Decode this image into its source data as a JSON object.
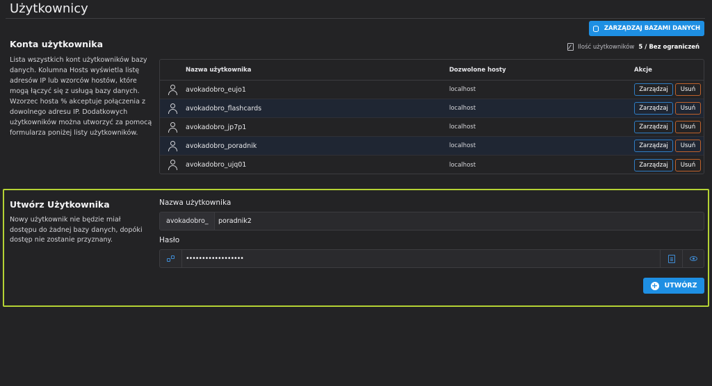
{
  "page": {
    "title": "Użytkownicy",
    "manage_db_label": "ZARZĄDZAJ BAZAMI DANYCH"
  },
  "accounts": {
    "title": "Konta użytkownika",
    "description": "Lista wszystkich kont użytkowników bazy danych. Kolumna Hosts wyświetla listę adresów IP lub wzorców hostów, które mogą łączyć się z usługą bazy danych. Wzorzec hosta % akceptuje połączenia z dowolnego adresu IP. Dodatkowych użytkowników można utworzyć za pomocą formularza poniżej listy użytkowników.",
    "count_label": "Ilość użytkowników",
    "count_value": "5 / Bez ograniczeń",
    "columns": [
      "Nazwa użytkownika",
      "Dozwolone hosty",
      "Akcje"
    ],
    "manage_label": "Zarządzaj",
    "delete_label": "Usuń",
    "rows": [
      {
        "name": "avokadobro_eujo1",
        "host": "localhost"
      },
      {
        "name": "avokadobro_flashcards",
        "host": "localhost"
      },
      {
        "name": "avokadobro_jp7p1",
        "host": "localhost"
      },
      {
        "name": "avokadobro_poradnik",
        "host": "localhost"
      },
      {
        "name": "avokadobro_ujq01",
        "host": "localhost"
      }
    ]
  },
  "create": {
    "title": "Utwórz Użytkownika",
    "description": "Nowy użytkownik nie będzie miał dostępu do żadnej bazy danych, dopóki dostęp nie zostanie przyznany.",
    "username_label": "Nazwa użytkownika",
    "username_prefix": "avokadobro_",
    "username_value": "poradnik2",
    "password_label": "Hasło",
    "password_value": "••••••••••••••••••",
    "submit_label": "UTWÓRZ"
  },
  "colors": {
    "accent": "#1e8fe3",
    "highlight_border": "#b5d334",
    "delete_border": "#c0622b"
  }
}
